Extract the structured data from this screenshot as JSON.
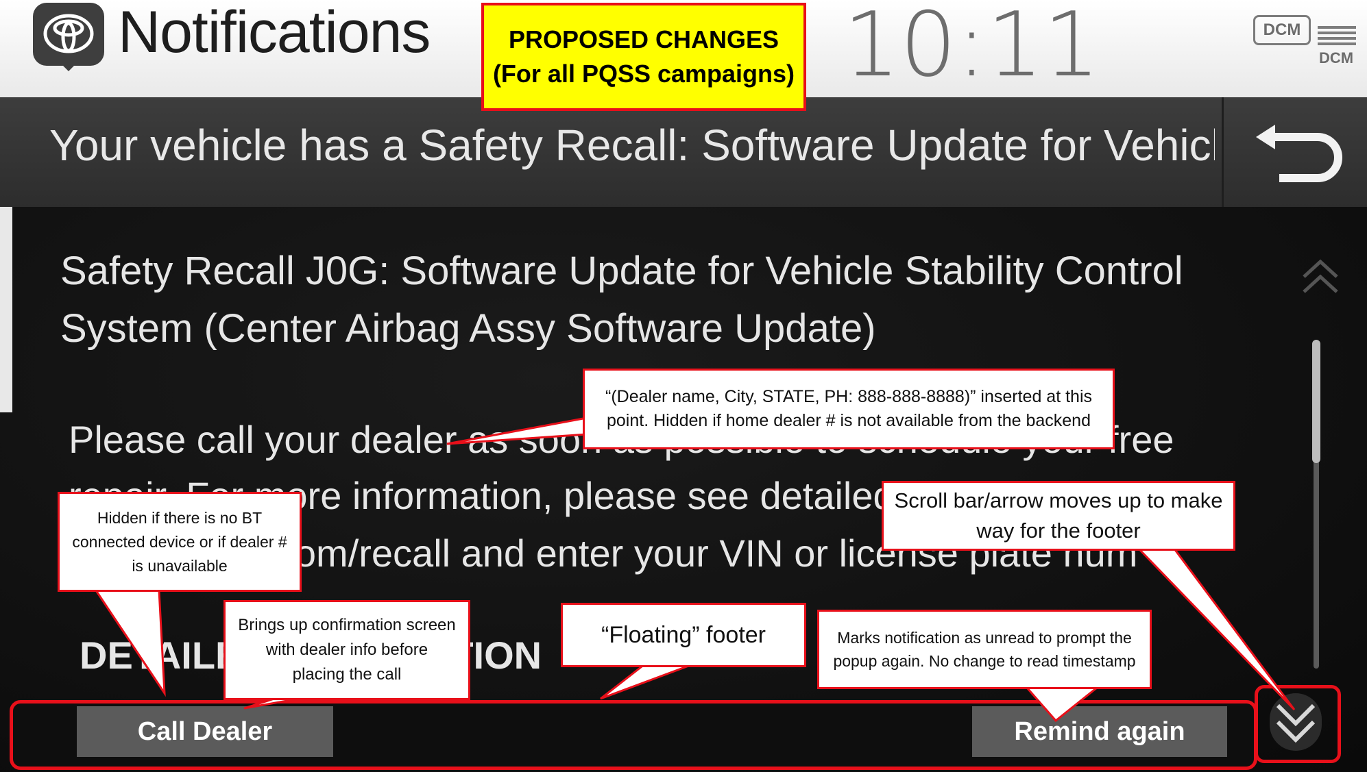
{
  "header": {
    "title": "Notifications",
    "clock": "10:11",
    "dcm_badge": "DCM",
    "dcm_label": "DCM"
  },
  "message": {
    "title": "Your vehicle has a Safety Recall: Software Update for Vehicle...",
    "back_icon": "back-arrow-icon"
  },
  "body": {
    "recall_title": "Safety Recall J0G: Software Update for Vehicle Stability Control System (Center Airbag Assy Software Update)",
    "lines": [
      "Please call your dealer as soon as possible to schedule your free",
      "repair.  For more information, please see detailed",
      "www.toyota.com/recall and enter your VIN or license plate num"
    ],
    "details_heading": "DETAILED DESCRIPTION"
  },
  "footer": {
    "call_dealer": "Call Dealer",
    "remind_again": "Remind again"
  },
  "annotations": {
    "proposal": "PROPOSED CHANGES (For all PQSS campaigns)",
    "dealer_insert": "“(Dealer name, City, STATE,  PH: 888-888-8888)” inserted at this point. Hidden if home dealer # is not available from the backend",
    "hidden_no_bt": "Hidden if there is no BT connected device or if dealer # is unavailable",
    "confirmation": "Brings up confirmation screen with dealer info before placing the call",
    "floating_footer": "“Floating” footer",
    "mark_unread": "Marks notification as unread to prompt the popup again. No change to read timestamp",
    "scroll_bar": "Scroll bar/arrow moves up to make way for the footer"
  },
  "colors": {
    "annotation_border": "#e8101a",
    "proposal_fill": "#ffff00",
    "button_fill": "#5b5b5b"
  }
}
